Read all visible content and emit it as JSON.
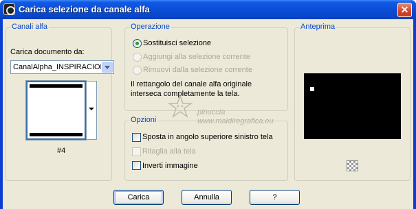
{
  "window": {
    "title": "Carica selezione da canale alfa",
    "close_glyph": "✕"
  },
  "canali": {
    "legend": "Canali alfa",
    "doc_label": "Carica documento da:",
    "doc_value": "CanalAlpha_INSPIRACION",
    "thumb_caption": "#4"
  },
  "operazione": {
    "legend": "Operazione",
    "options": [
      {
        "label": "Sostituisci selezione",
        "selected": true,
        "enabled": true
      },
      {
        "label": "Aggiungi alla selezione corrente",
        "selected": false,
        "enabled": false
      },
      {
        "label": "Rimuovi dalla selezione corrente",
        "selected": false,
        "enabled": false
      }
    ],
    "info_line1": "Il rettangolo del canale alfa originale",
    "info_line2": "interseca completamente la tela."
  },
  "opzioni": {
    "legend": "Opzioni",
    "items": [
      {
        "label": "Sposta in angolo superiore sinistro tela",
        "checked": false,
        "enabled": true
      },
      {
        "label": "Ritaglia alla tela",
        "checked": false,
        "enabled": false
      },
      {
        "label": "Inverti immagine",
        "checked": false,
        "enabled": true
      }
    ]
  },
  "anteprima": {
    "legend": "Anteprima"
  },
  "watermark": {
    "line1": "pinuccia",
    "line2": "www.maidiregrafica.eu"
  },
  "buttons": {
    "carica": "Carica",
    "annulla": "Annulla",
    "help": "?"
  },
  "icons": {
    "app": "app-icon",
    "close": "close-icon",
    "dropdown": "chevron-down-icon",
    "checker": "transparency-checker-icon"
  }
}
